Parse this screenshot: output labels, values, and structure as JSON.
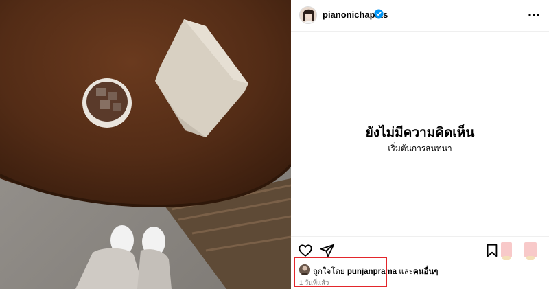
{
  "post": {
    "username": "pianonichapats",
    "verified": true
  },
  "comments": {
    "empty_title": "ยังไม่มีความคิดเห็น",
    "empty_subtitle": "เริ่มต้นการสนทนา"
  },
  "likes": {
    "prefix": "ถูกใจโดย",
    "user": "punjanprama",
    "suffix": "และ",
    "others": "คนอื่นๆ",
    "time": "1 วันที่แล้ว"
  },
  "colors": {
    "verified": "#0095f6",
    "highlight_box": "#e3262b",
    "muted_text": "#737373"
  },
  "icons": {
    "more": "more-options-icon",
    "like": "heart-icon",
    "share": "share-icon",
    "save": "bookmark-icon"
  }
}
